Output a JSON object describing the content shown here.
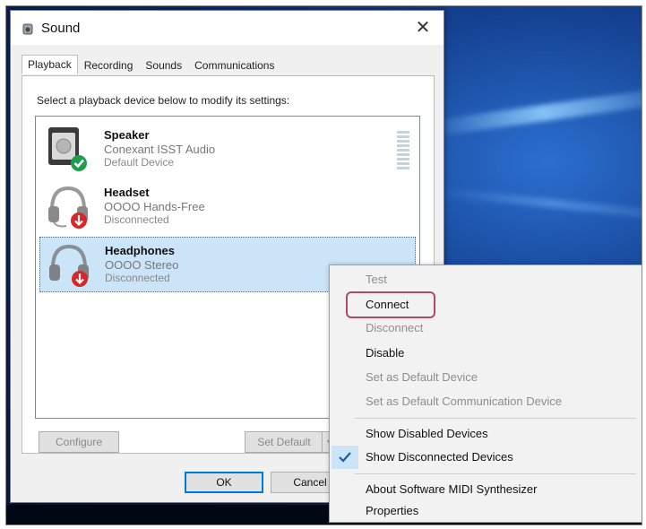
{
  "dialog": {
    "title": "Sound",
    "close_glyph": "✕",
    "tabs": [
      {
        "label": "Playback",
        "active": true
      },
      {
        "label": "Recording",
        "active": false
      },
      {
        "label": "Sounds",
        "active": false
      },
      {
        "label": "Communications",
        "active": false
      }
    ],
    "instruction": "Select a playback device below to modify its settings:",
    "devices": [
      {
        "name": "Speaker",
        "sub": "Conexant ISST Audio",
        "status": "Default Device",
        "icon": "speaker-icon",
        "badge": "default-check-icon",
        "selected": false
      },
      {
        "name": "Headset",
        "sub": "OOOO Hands-Free",
        "status": "Disconnected",
        "icon": "headset-icon",
        "badge": "disconnected-arrow-icon",
        "selected": false
      },
      {
        "name": "Headphones",
        "sub": "OOOO Stereo",
        "status": "Disconnected",
        "icon": "headphones-icon",
        "badge": "disconnected-arrow-icon",
        "selected": true
      }
    ],
    "buttons": {
      "configure": "Configure",
      "set_default": "Set Default",
      "ok": "OK",
      "cancel": "Cancel"
    }
  },
  "context_menu": {
    "items": [
      {
        "label": "Test",
        "enabled": false
      },
      {
        "label": "Connect",
        "enabled": true,
        "highlighted": true
      },
      {
        "label": "Disconnect",
        "enabled": false
      },
      {
        "label": "Disable",
        "enabled": true
      },
      {
        "label": "Set as Default Device",
        "enabled": false
      },
      {
        "label": "Set as Default Communication Device",
        "enabled": false
      },
      {
        "label": "Show Disabled Devices",
        "enabled": true
      },
      {
        "label": "Show Disconnected Devices",
        "enabled": true,
        "checked": true
      },
      {
        "label": "About Software MIDI Synthesizer",
        "enabled": true
      },
      {
        "label": "Properties",
        "enabled": true
      }
    ]
  },
  "colors": {
    "accent": "#0078d7",
    "default_badge": "#1e9e4a",
    "disconnect_badge": "#d62828",
    "highlight_ring": "#b04a6b",
    "selection": "#cce4f7"
  }
}
